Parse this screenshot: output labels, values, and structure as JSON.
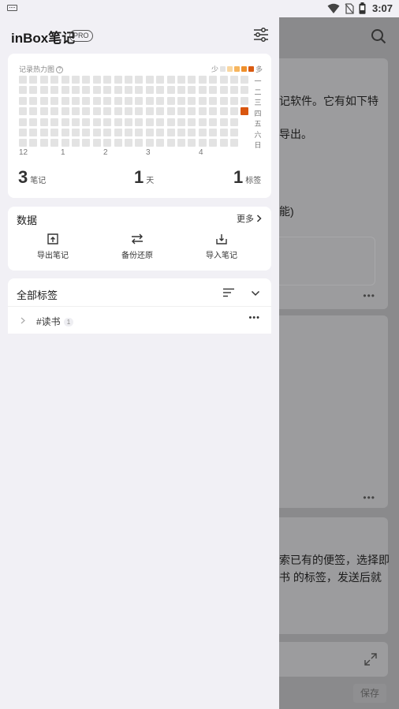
{
  "status_bar": {
    "time": "3:07",
    "icons": [
      "keyboard-icon",
      "wifi-icon",
      "no-sim-icon",
      "battery-icon"
    ]
  },
  "drawer": {
    "app_title": "inBox笔记",
    "pro_badge": "PRO",
    "heatmap": {
      "title": "记录热力图",
      "help": "?",
      "legend_less": "少",
      "legend_more": "多",
      "legend_colors": [
        "#e3e3e3",
        "#f9d6a0",
        "#f6b55e",
        "#ef8f2a",
        "#d95a10"
      ],
      "weekdays": [
        "一",
        "二",
        "三",
        "四",
        "五",
        "六",
        "日"
      ],
      "months": [
        "12",
        "1",
        "2",
        "3",
        "4"
      ],
      "active_cell": {
        "week": 21,
        "weekday": "四",
        "color": "#d9560f"
      }
    },
    "stats": [
      {
        "value": "3",
        "unit": "笔记"
      },
      {
        "value": "1",
        "unit": "天"
      },
      {
        "value": "1",
        "unit": "标签"
      }
    ],
    "data_section": {
      "title": "数据",
      "more_label": "更多",
      "actions": [
        {
          "label": "导出笔记",
          "icon": "export-icon"
        },
        {
          "label": "备份还原",
          "icon": "swap-icon"
        },
        {
          "label": "导入笔记",
          "icon": "import-icon"
        }
      ]
    },
    "tags_section": {
      "title": "全部标签",
      "tags": [
        {
          "name": "#读书",
          "count": "1"
        }
      ]
    }
  },
  "background": {
    "card1_lines": [
      "记软件。它有如下特",
      "导出。",
      "能)"
    ],
    "card3_lines": [
      "索已有的便签，选择即",
      "书 的标签，发送后就"
    ],
    "save_label": "保存"
  }
}
